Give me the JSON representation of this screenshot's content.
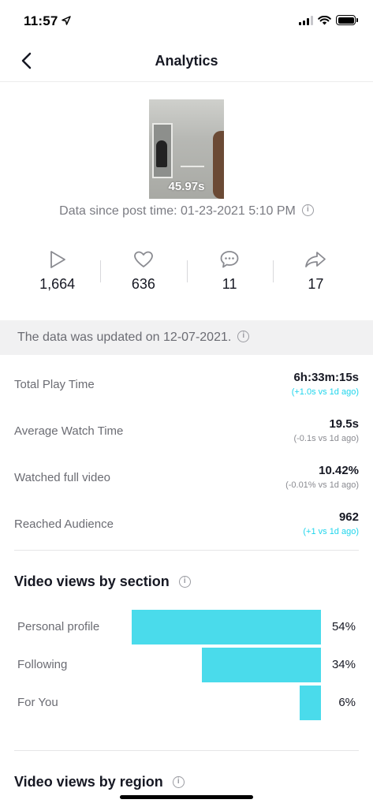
{
  "status_bar": {
    "time": "11:57"
  },
  "nav": {
    "title": "Analytics"
  },
  "video": {
    "duration": "45.97s"
  },
  "data_since": "Data since post time: 01-23-2021 5:10 PM",
  "stats": {
    "plays": "1,664",
    "likes": "636",
    "comments": "11",
    "shares": "17"
  },
  "updated_notice": "The data was updated on 12-07-2021.",
  "metrics": [
    {
      "label": "Total Play Time",
      "value": "6h:33m:15s",
      "delta": "(+1.0s vs 1d ago)"
    },
    {
      "label": "Average Watch Time",
      "value": "19.5s",
      "delta": "(-0.1s vs 1d ago)"
    },
    {
      "label": "Watched full video",
      "value": "10.42%",
      "delta": "(-0.01% vs 1d ago)"
    },
    {
      "label": "Reached Audience",
      "value": "962",
      "delta": "(+1 vs 1d ago)"
    }
  ],
  "sections": {
    "views_by_section": "Video views by section",
    "views_by_region": "Video views by region"
  },
  "section_bars": [
    {
      "label": "Personal profile",
      "pct_text": "54%",
      "value": 54
    },
    {
      "label": "Following",
      "pct_text": "34%",
      "value": 34
    },
    {
      "label": "For You",
      "pct_text": "6%",
      "value": 6
    }
  ],
  "colors": {
    "accent_cyan": "#20d5ec",
    "bar_fill": "#4adbeb",
    "text_primary": "#161823",
    "text_secondary": "#6b6c73"
  },
  "icons": {
    "back": "chevron-left-icon",
    "play": "play-icon",
    "like": "heart-icon",
    "comment": "comment-icon",
    "share": "share-icon",
    "info": "info-icon"
  }
}
